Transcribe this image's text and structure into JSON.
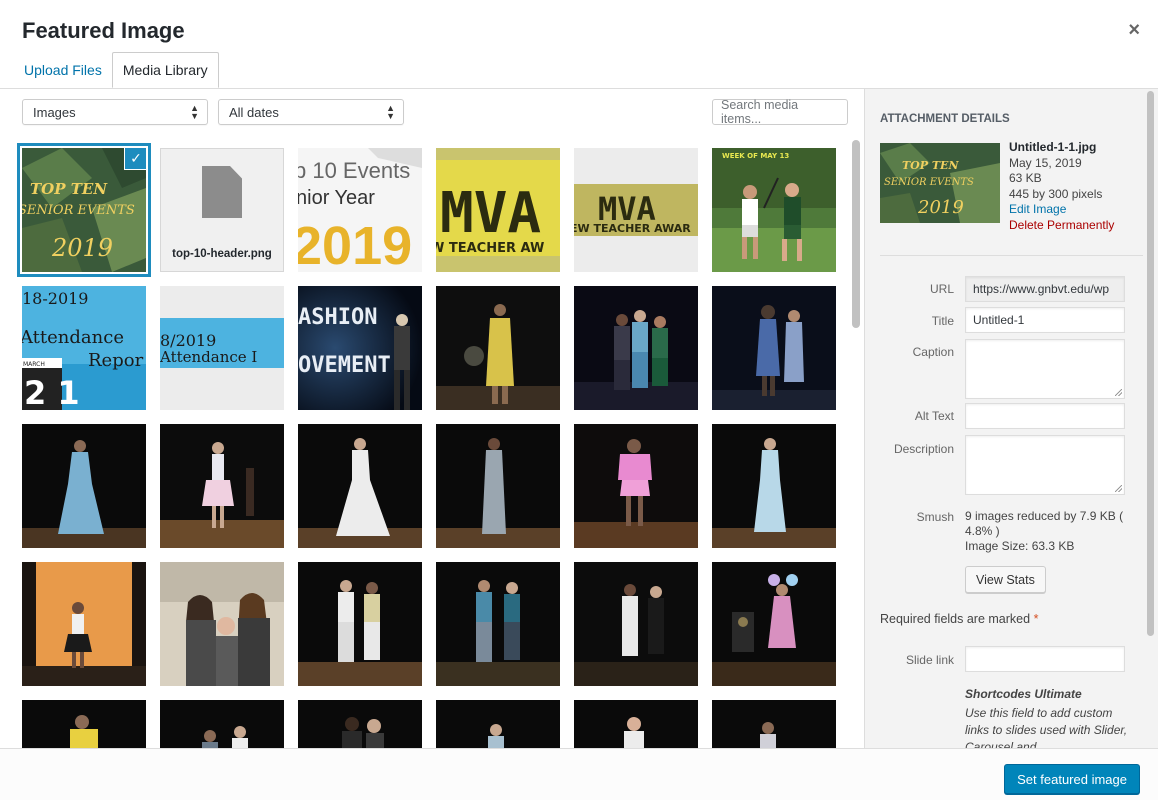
{
  "modal": {
    "title": "Featured Image",
    "close": "×"
  },
  "tabs": [
    {
      "label": "Upload Files",
      "active": false
    },
    {
      "label": "Media Library",
      "active": true
    }
  ],
  "filters": {
    "type_value": "Images",
    "date_value": "All dates",
    "search_placeholder": "Search media items..."
  },
  "thumbnails": {
    "file_name": "top-10-header.png",
    "top10_line1": "TOP TEN",
    "top10_line2": "SENIOR EVENTS",
    "top10_year": "2019",
    "events_line1": "p 10 Events",
    "events_line2": "nior Year",
    "events_year": "2019",
    "mva": "MVA",
    "mva_sub1": "W TEACHER AW",
    "mva_sub2": "EW TEACHER AWAR",
    "week_label": "WEEK OF MAY 13",
    "att_year": "18-2019",
    "att_word": "Attendance",
    "att_report": "Repor",
    "march": "MARCH",
    "att2_year": "8/2019",
    "att2_word": "Attendance I",
    "fashion1": "ASHION",
    "fashion2": "OVEMENT"
  },
  "sidebar": {
    "heading": "ATTACHMENT DETAILS",
    "filename": "Untitled-1-1.jpg",
    "date": "May 15, 2019",
    "size": "63 KB",
    "dimensions": "445 by 300 pixels",
    "edit_link": "Edit Image",
    "delete_link": "Delete Permanently",
    "fields": {
      "url_label": "URL",
      "url_value": "https://www.gnbvt.edu/wp",
      "title_label": "Title",
      "title_value": "Untitled-1",
      "caption_label": "Caption",
      "alt_label": "Alt Text",
      "description_label": "Description",
      "smush_label": "Smush"
    },
    "smush_line1": "9 images reduced by 7.9 KB ( 4.8% )",
    "smush_line2": "Image Size: 63.3 KB",
    "view_stats": "View Stats",
    "required_text": "Required fields are marked",
    "required_star": "*",
    "slide_link_label": "Slide link",
    "shortcodes_title": "Shortcodes Ultimate",
    "shortcodes_desc": "Use this field to add custom links to slides used with Slider, Carousel and"
  },
  "footer": {
    "primary_button": "Set featured image"
  },
  "colors": {
    "accent": "#0085ba",
    "link": "#0073aa",
    "delete": "#aa0000",
    "selected_outline": "#1e8cbe"
  }
}
